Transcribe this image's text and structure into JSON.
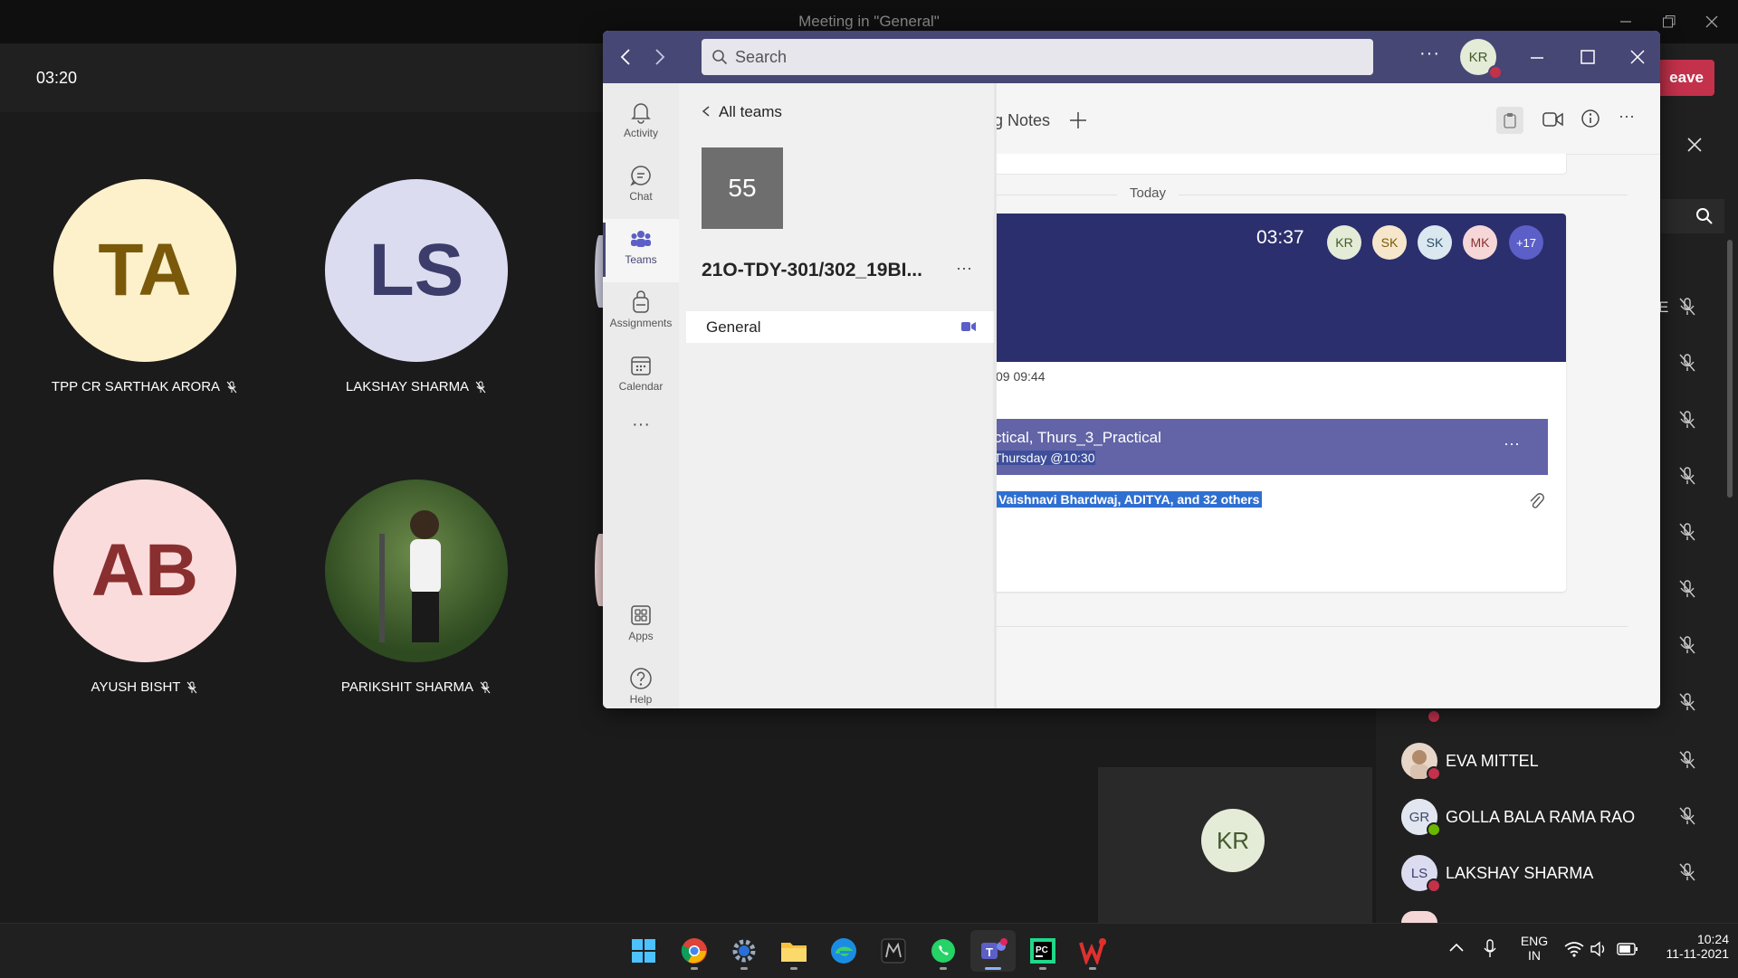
{
  "meeting": {
    "window_title": "Meeting in \"General\"",
    "timer": "03:20",
    "leave_label": "eave",
    "self_initials": "KR"
  },
  "tiles": [
    {
      "initials": "TA",
      "name": "TPP CR SARTHAK ARORA",
      "bg": "#fdf1cc",
      "fg": "#7a5a0a"
    },
    {
      "initials": "LS",
      "name": "LAKSHAY SHARMA",
      "bg": "#dcdcf0",
      "fg": "#3d3d6b"
    },
    {
      "initials": "AB",
      "name": "AYUSH BISHT",
      "bg": "#fbdcdc",
      "fg": "#8a2f2f"
    },
    {
      "initials": "",
      "name": "PARIKSHIT SHARMA",
      "bg": "#3a5a2a",
      "fg": "#ffffff"
    }
  ],
  "participants": {
    "partial_top": "E",
    "rows": [
      {
        "initials": "",
        "name": "EVA MITTEL",
        "bg": "#e8d6c8",
        "status": "#c4314b"
      },
      {
        "initials": "GR",
        "name": "GOLLA BALA RAMA RAO",
        "bg": "#e2e6f0",
        "status": "#6bb700"
      },
      {
        "initials": "LS",
        "name": "LAKSHAY SHARMA",
        "bg": "#dcdcf0",
        "status": "#c4314b"
      }
    ]
  },
  "teams": {
    "search_placeholder": "Search",
    "more": "···",
    "user_initials": "KR",
    "rail": [
      "Activity",
      "Chat",
      "Teams",
      "Assignments",
      "Calendar",
      "Apps",
      "Help"
    ],
    "rail_more": "···",
    "all_teams": "All teams",
    "team_number": "55",
    "team_name": "21O-TDY-301/302_19BI...",
    "team_more": "···",
    "channel": "General",
    "tab_label": "g Notes",
    "today": "Today",
    "meeting_time": "03:37",
    "avatars": [
      {
        "initials": "KR",
        "bg": "#e4ecd8",
        "fg": "#445a2b"
      },
      {
        "initials": "SK",
        "bg": "#f6e7cc",
        "fg": "#7a5a0a"
      },
      {
        "initials": "SK",
        "bg": "#dbe8f0",
        "fg": "#2b4f6b"
      },
      {
        "initials": "MK",
        "bg": "#f6d7d7",
        "fg": "#8a2f2f"
      }
    ],
    "avatar_more": "+17",
    "timestamp": "09 09:44",
    "card_title": "ctical, Thurs_3_Practical",
    "card_subtitle": "Thursday @10:30",
    "card_more": "···",
    "attendees": "Vaishnavi Bhardwaj, ADITYA, and 32 others"
  },
  "taskbar": {
    "lang": "ENG",
    "region": "IN",
    "time": "10:24",
    "date": "11-11-2021",
    "icons": [
      "start-icon",
      "chrome-icon",
      "settings-icon",
      "file-explorer-icon",
      "edge-icon",
      "predator-icon",
      "whatsapp-icon",
      "teams-icon",
      "pycharm-icon",
      "wps-office-icon"
    ]
  },
  "colors": {
    "teams_header": "#464775",
    "meeting_banner": "#2b2f6d",
    "card_bar": "#6264a7",
    "leave": "#c4314b"
  }
}
